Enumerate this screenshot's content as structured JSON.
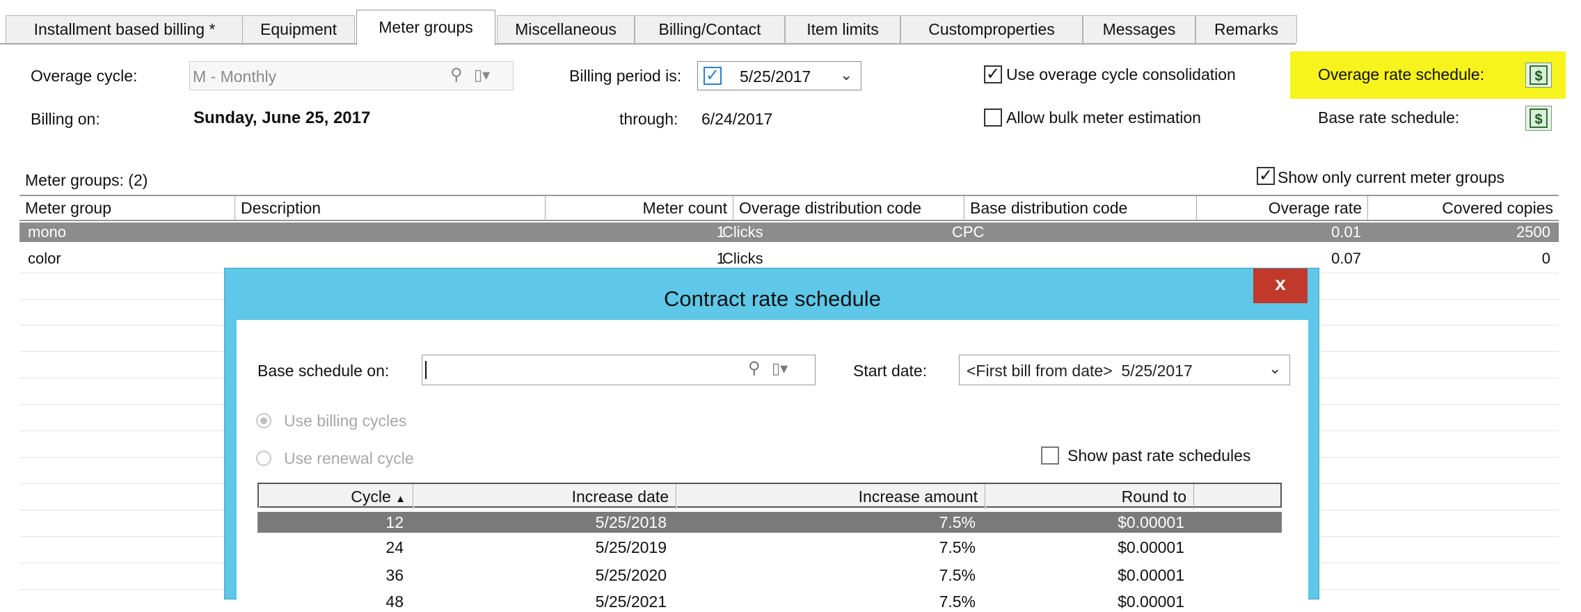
{
  "tabs": [
    {
      "label": "Installment based billing *"
    },
    {
      "label": "Equipment"
    },
    {
      "label": "Meter groups"
    },
    {
      "label": "Miscellaneous"
    },
    {
      "label": "Billing/Contact"
    },
    {
      "label": "Item limits"
    },
    {
      "label": "Customproperties"
    },
    {
      "label": "Messages"
    },
    {
      "label": "Remarks"
    }
  ],
  "form": {
    "overage_cycle_label": "Overage cycle:",
    "overage_cycle_value": "M - Monthly",
    "billing_period_label": "Billing period is:",
    "billing_period_value": "5/25/2017",
    "use_consolidation_label": "Use overage cycle consolidation",
    "overage_rate_schedule_label": "Overage rate schedule:",
    "billing_on_label": "Billing on:",
    "billing_on_value": "Sunday, June 25, 2017",
    "through_label": "through:",
    "through_value": "6/24/2017",
    "bulk_estimation_label": "Allow bulk meter estimation",
    "base_rate_schedule_label": "Base rate schedule:",
    "highlight_color": "#f7f31c"
  },
  "meter_groups": {
    "title": "Meter groups: (2)",
    "show_current_label": "Show only current meter groups",
    "columns": [
      "Meter group",
      "Description",
      "Meter count",
      "Overage distribution code",
      "Base distribution code",
      "Overage rate",
      "Covered copies"
    ],
    "rows": [
      {
        "group": "mono",
        "description": "",
        "count": "1",
        "overage_code": "Clicks",
        "base_code": "CPC",
        "rate": "0.01",
        "copies": "2500"
      },
      {
        "group": "color",
        "description": "",
        "count": "1",
        "overage_code": "Clicks",
        "base_code": "",
        "rate": "0.07",
        "copies": "0"
      }
    ]
  },
  "dialog": {
    "title": "Contract rate schedule",
    "close_glyph": "x",
    "base_schedule_label": "Base schedule on:",
    "base_schedule_value": "",
    "start_date_label": "Start date:",
    "start_date_value": "<First bill from date>  5/25/2017",
    "use_billing_cycles_label": "Use billing cycles",
    "use_renewal_cycle_label": "Use renewal cycle",
    "show_past_label": "Show past rate schedules",
    "columns": [
      "Cycle",
      "Increase date",
      "Increase amount",
      "Round to"
    ],
    "rows": [
      {
        "cycle": "12",
        "date": "5/25/2018",
        "amount": "7.5%",
        "round": "$0.00001"
      },
      {
        "cycle": "24",
        "date": "5/25/2019",
        "amount": "7.5%",
        "round": "$0.00001"
      },
      {
        "cycle": "36",
        "date": "5/25/2020",
        "amount": "7.5%",
        "round": "$0.00001"
      },
      {
        "cycle": "48",
        "date": "5/25/2021",
        "amount": "7.5%",
        "round": "$0.00001"
      }
    ],
    "accent_color": "#5fc8e8",
    "close_color": "#c0392b",
    "selected_row_color": "#7a7a7a"
  }
}
